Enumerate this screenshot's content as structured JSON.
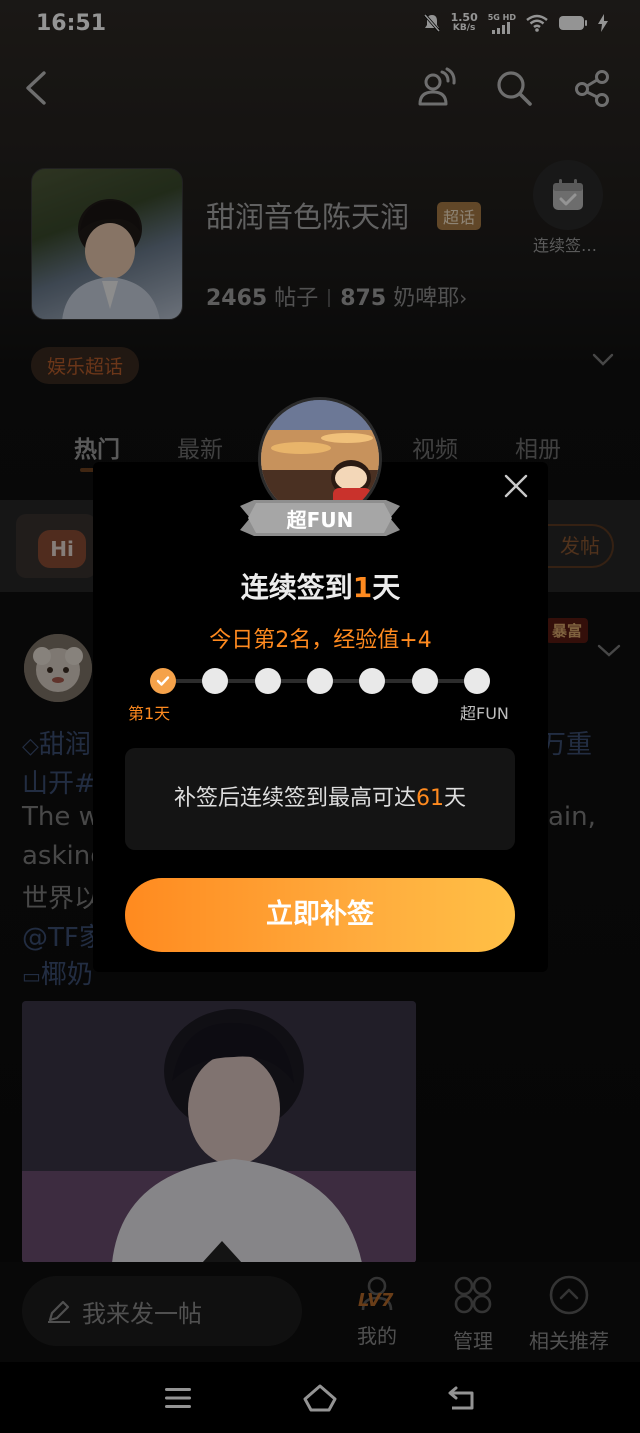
{
  "status_bar": {
    "time": "16:51",
    "net_speed_value": "1.50",
    "net_speed_unit": "KB/s",
    "network_type": "5G HD"
  },
  "header": {
    "topic_title": "甜润音色陈天润",
    "topic_badge": "超话",
    "checkin_label": "连续签…",
    "posts_count": "2465",
    "posts_label": "帖子",
    "fans_count": "875",
    "fans_label": "奶啤耶",
    "category_tag": "娱乐超话"
  },
  "tabs": [
    {
      "label": "热门"
    },
    {
      "label": "最新"
    },
    {
      "label": "视频"
    },
    {
      "label": "相册"
    }
  ],
  "banner": {
    "hi_text": "Hi",
    "post_button": "发帖"
  },
  "feed": {
    "rich_badge": "暴富",
    "line1_left": "甜润",
    "line1_right": "万重",
    "line2": "山开#",
    "line3_left": "The w",
    "line3_right": "ain,",
    "line4": "asking",
    "line5": "世界以",
    "line6": "@TF家",
    "line7": "椰奶"
  },
  "modal": {
    "badge_label": "超FUN",
    "title_prefix": "连续签到",
    "title_days": "1",
    "title_suffix": "天",
    "subtitle": "今日第2名，经验值+4",
    "progress_start_label": "第1天",
    "progress_end_label": "超FUN",
    "progress_done": 1,
    "progress_total": 7,
    "info_prefix": "补签后连续签到最高可达",
    "info_days": "61",
    "info_suffix": "天",
    "cta_label": "立即补签"
  },
  "bottom_bar": {
    "compose_placeholder": "我来发一帖",
    "level_badge": "LV7",
    "mine_label": "我的",
    "manage_label": "管理",
    "related_label": "相关推荐"
  },
  "colors": {
    "accent_orange": "#ff8a1f",
    "badge_gold": "#a77a45",
    "progress_done": "#f5a24a"
  },
  "icons": [
    "back-icon",
    "group-icon",
    "search-icon",
    "share-icon",
    "calendar-check-icon",
    "chevron-down-icon",
    "close-icon",
    "check-icon",
    "pencil-icon",
    "user-icon",
    "grid-icon",
    "up-circle-icon",
    "menu-icon",
    "home-icon",
    "return-icon"
  ]
}
